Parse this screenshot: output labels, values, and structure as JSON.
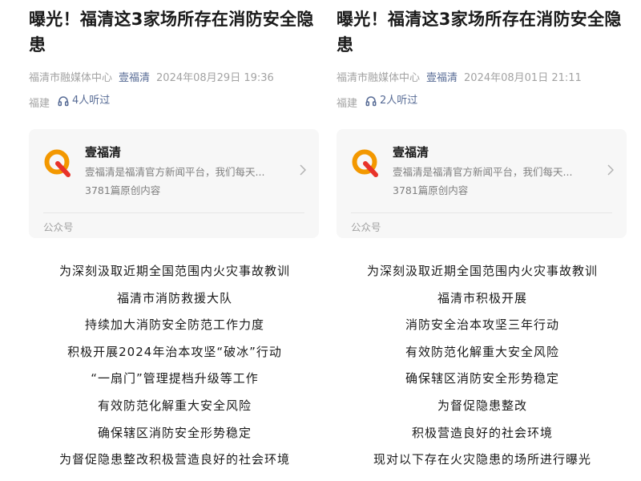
{
  "articles": [
    {
      "title": "曝光！福清这3家场所存在消防安全隐患",
      "source": "福清市融媒体中心",
      "account_link": "壹福清",
      "date": "2024年08月29日 19:36",
      "location": "福建",
      "listeners": "4人听过",
      "card": {
        "name": "壹福清",
        "description": "壹福清是福清官方新闻平台，我们每天...",
        "count": "3781篇原创内容",
        "label": "公众号"
      },
      "lines": [
        "为深刻汲取近期全国范围内火灾事故教训",
        "福清市消防救援大队",
        "持续加大消防安全防范工作力度",
        "积极开展2024年治本攻坚“破冰”行动",
        "“一扇门”管理提档升级等工作",
        "有效防范化解重大安全风险",
        "确保辖区消防安全形势稳定",
        "为督促隐患整改积极营造良好的社会环境"
      ]
    },
    {
      "title": "曝光！福清这3家场所存在消防安全隐患",
      "source": "福清市融媒体中心",
      "account_link": "壹福清",
      "date": "2024年08月01日 21:11",
      "location": "福建",
      "listeners": "2人听过",
      "card": {
        "name": "壹福清",
        "description": "壹福清是福清官方新闻平台，我们每天...",
        "count": "3781篇原创内容",
        "label": "公众号"
      },
      "lines": [
        "为深刻汲取近期全国范围内火灾事故教训",
        "福清市积极开展",
        "消防安全治本攻坚三年行动",
        "有效防范化解重大安全风险",
        "确保辖区消防安全形势稳定",
        "为督促隐患整改",
        "积极营造良好的社会环境",
        "现对以下存在火灾隐患的场所进行曝光"
      ]
    }
  ],
  "colors": {
    "link": "#576b95",
    "logo_orange": "#f39800",
    "logo_red": "#e8332a",
    "card_bg": "#f7f7f7"
  },
  "icons": {
    "listen": "headphone-icon",
    "logo": "fuqing-q-logo",
    "card_arrow": "chevron-right-icon"
  }
}
